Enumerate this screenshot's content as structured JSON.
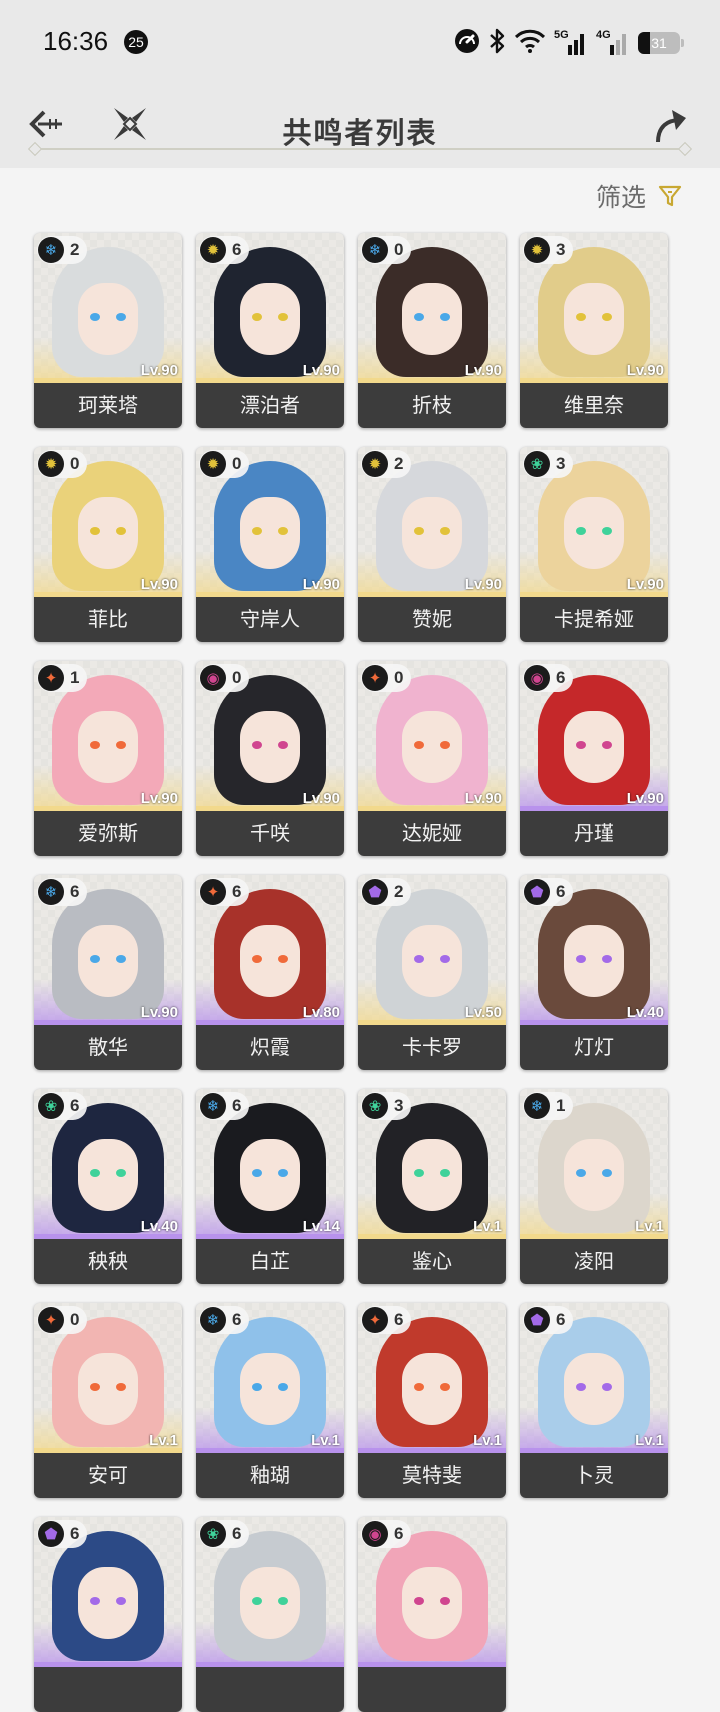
{
  "status_bar": {
    "time": "16:36",
    "notification_count": "25",
    "network_5g": "5G",
    "network_4g": "4G",
    "battery": "31"
  },
  "header": {
    "title": "共鸣者列表"
  },
  "filter": {
    "label": "筛选",
    "accent": "#c8a832"
  },
  "elements": {
    "glacio": {
      "glyph": "❄",
      "color": "#4aa8e8"
    },
    "spectro": {
      "glyph": "✹",
      "color": "#e2c23a"
    },
    "aero": {
      "glyph": "❀",
      "color": "#3fd29a"
    },
    "fusion": {
      "glyph": "✦",
      "color": "#f06a3a"
    },
    "havoc": {
      "glyph": "◉",
      "color": "#d0458f"
    },
    "electro": {
      "glyph": "⬟",
      "color": "#a36ae8"
    }
  },
  "characters": [
    {
      "name": "珂莱塔",
      "level": "Lv.90",
      "sequence": "2",
      "element": "glacio",
      "rarity": 5,
      "hair": "#d9dcdd"
    },
    {
      "name": "漂泊者",
      "level": "Lv.90",
      "sequence": "6",
      "element": "spectro",
      "rarity": 5,
      "hair": "#1f2430"
    },
    {
      "name": "折枝",
      "level": "Lv.90",
      "sequence": "0",
      "element": "glacio",
      "rarity": 5,
      "hair": "#3b2c28"
    },
    {
      "name": "维里奈",
      "level": "Lv.90",
      "sequence": "3",
      "element": "spectro",
      "rarity": 5,
      "hair": "#e1cc8a"
    },
    {
      "name": "菲比",
      "level": "Lv.90",
      "sequence": "0",
      "element": "spectro",
      "rarity": 5,
      "hair": "#ead27a"
    },
    {
      "name": "守岸人",
      "level": "Lv.90",
      "sequence": "0",
      "element": "spectro",
      "rarity": 5,
      "hair": "#4a86c4"
    },
    {
      "name": "赞妮",
      "level": "Lv.90",
      "sequence": "2",
      "element": "spectro",
      "rarity": 5,
      "hair": "#d6d8dc"
    },
    {
      "name": "卡提希娅",
      "level": "Lv.90",
      "sequence": "3",
      "element": "aero",
      "rarity": 5,
      "hair": "#ecd39c"
    },
    {
      "name": "爱弥斯",
      "level": "Lv.90",
      "sequence": "1",
      "element": "fusion",
      "rarity": 5,
      "hair": "#f3a9b8"
    },
    {
      "name": "千咲",
      "level": "Lv.90",
      "sequence": "0",
      "element": "havoc",
      "rarity": 5,
      "hair": "#26262b"
    },
    {
      "name": "达妮娅",
      "level": "Lv.90",
      "sequence": "0",
      "element": "fusion",
      "rarity": 5,
      "hair": "#f0b3cf"
    },
    {
      "name": "丹瑾",
      "level": "Lv.90",
      "sequence": "6",
      "element": "havoc",
      "rarity": 4,
      "hair": "#c5282a"
    },
    {
      "name": "散华",
      "level": "Lv.90",
      "sequence": "6",
      "element": "glacio",
      "rarity": 4,
      "hair": "#b9bcc2"
    },
    {
      "name": "炽霞",
      "level": "Lv.80",
      "sequence": "6",
      "element": "fusion",
      "rarity": 4,
      "hair": "#a8322a"
    },
    {
      "name": "卡卡罗",
      "level": "Lv.50",
      "sequence": "2",
      "element": "electro",
      "rarity": 5,
      "hair": "#cfd3d6"
    },
    {
      "name": "灯灯",
      "level": "Lv.40",
      "sequence": "6",
      "element": "electro",
      "rarity": 4,
      "hair": "#6a4a3c"
    },
    {
      "name": "秧秧",
      "level": "Lv.40",
      "sequence": "6",
      "element": "aero",
      "rarity": 4,
      "hair": "#1e2640"
    },
    {
      "name": "白芷",
      "level": "Lv.14",
      "sequence": "6",
      "element": "glacio",
      "rarity": 4,
      "hair": "#1a1b1f"
    },
    {
      "name": "鉴心",
      "level": "Lv.1",
      "sequence": "3",
      "element": "aero",
      "rarity": 5,
      "hair": "#222226"
    },
    {
      "name": "凌阳",
      "level": "Lv.1",
      "sequence": "1",
      "element": "glacio",
      "rarity": 5,
      "hair": "#dcd6cc"
    },
    {
      "name": "安可",
      "level": "Lv.1",
      "sequence": "0",
      "element": "fusion",
      "rarity": 5,
      "hair": "#f2b5b2"
    },
    {
      "name": "釉瑚",
      "level": "Lv.1",
      "sequence": "6",
      "element": "glacio",
      "rarity": 4,
      "hair": "#8fc1ea"
    },
    {
      "name": "莫特斐",
      "level": "Lv.1",
      "sequence": "6",
      "element": "fusion",
      "rarity": 4,
      "hair": "#c03a2c"
    },
    {
      "name": "卜灵",
      "level": "Lv.1",
      "sequence": "6",
      "element": "electro",
      "rarity": 4,
      "hair": "#a9cdea"
    },
    {
      "name": "",
      "level": "",
      "sequence": "6",
      "element": "electro",
      "rarity": 4,
      "hair": "#2c4a86"
    },
    {
      "name": "",
      "level": "",
      "sequence": "6",
      "element": "aero",
      "rarity": 4,
      "hair": "#c6cbd0"
    },
    {
      "name": "",
      "level": "",
      "sequence": "6",
      "element": "havoc",
      "rarity": 4,
      "hair": "#f1a5b8"
    }
  ],
  "rarity_colors": {
    "5": "#f2d98c",
    "4": "#b892ec"
  }
}
